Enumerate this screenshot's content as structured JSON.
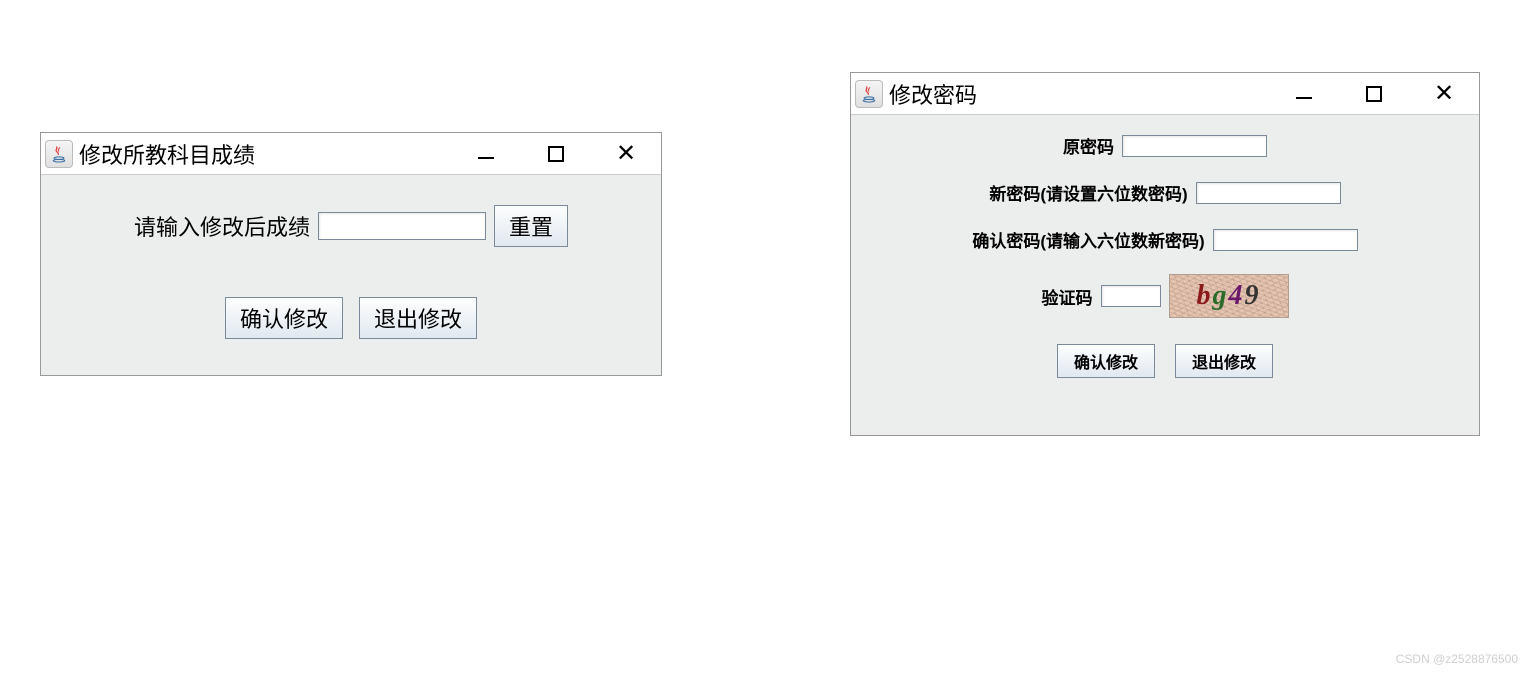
{
  "window1": {
    "title": "修改所教科目成绩",
    "score_label": "请输入修改后成绩",
    "score_value": "",
    "reset_button": "重置",
    "confirm_button": "确认修改",
    "exit_button": "退出修改"
  },
  "window2": {
    "title": "修改密码",
    "old_password_label": "原密码",
    "old_password_value": "",
    "new_password_label": "新密码(请设置六位数密码)",
    "new_password_value": "",
    "confirm_password_label": "确认密码(请输入六位数新密码)",
    "confirm_password_value": "",
    "captcha_label": "验证码",
    "captcha_value": "",
    "captcha_text": "bg49",
    "confirm_button": "确认修改",
    "exit_button": "退出修改"
  },
  "watermark": "CSDN @z2528876500"
}
